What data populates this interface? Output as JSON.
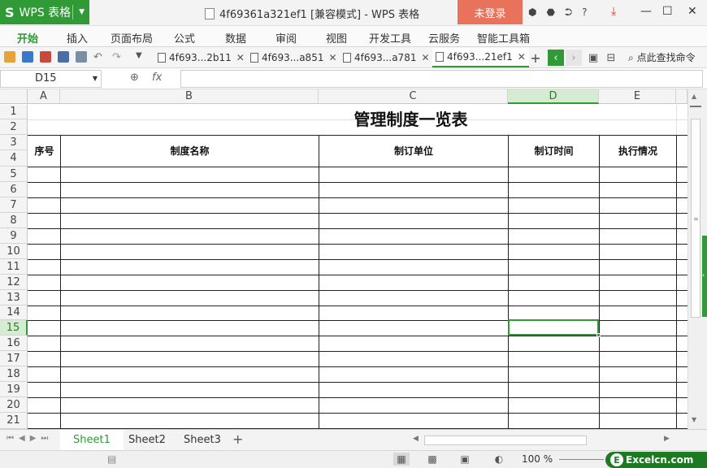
{
  "app": {
    "name": "WPS 表格",
    "logo": "S",
    "window_title": "4f69361a321ef1 [兼容模式] - WPS 表格",
    "login": "未登录",
    "help": "?"
  },
  "menu": [
    "开始",
    "插入",
    "页面布局",
    "公式",
    "数据",
    "审阅",
    "视图",
    "开发工具",
    "云服务",
    "智能工具箱"
  ],
  "doc_tabs": [
    "4f693...2b11",
    "4f693...a851",
    "4f693...a781",
    "4f693...21ef1"
  ],
  "find_command": "点此查找命令",
  "formula_bar": {
    "cell_ref": "D15",
    "fx": "fx",
    "value": ""
  },
  "columns": [
    "A",
    "B",
    "C",
    "D",
    "E"
  ],
  "rows": [
    "1",
    "2",
    "3",
    "4",
    "5",
    "6",
    "7",
    "8",
    "9",
    "10",
    "11",
    "12",
    "13",
    "14",
    "15",
    "16",
    "17",
    "18",
    "19",
    "20",
    "21"
  ],
  "sheet": {
    "title": "管理制度一览表",
    "headers": [
      "序号",
      "制度名称",
      "制订单位",
      "制订时间",
      "执行情况"
    ]
  },
  "sheet_tabs": [
    "Sheet1",
    "Sheet2",
    "Sheet3"
  ],
  "status": {
    "zoom": "100 %",
    "brand": "Excelcn.com",
    "brand_letter": "E"
  },
  "colors": {
    "accent": "#2f9a36",
    "login_bg": "#e8735a"
  }
}
